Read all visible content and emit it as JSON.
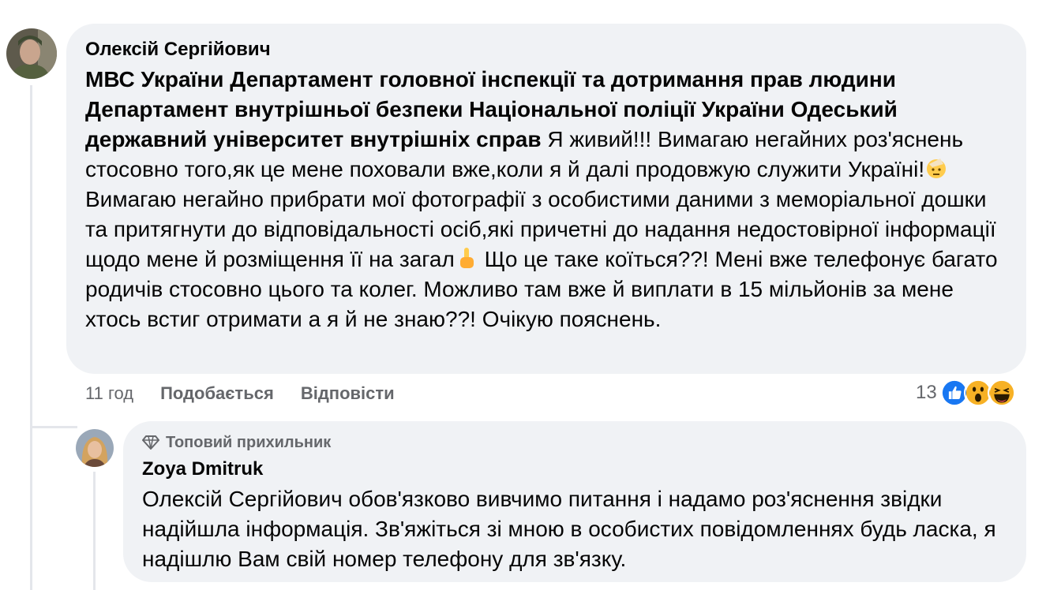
{
  "comment": {
    "author": "Олексій Сергійович",
    "tags": "МВС України Департамент головної інспекції та дотримання прав людини Департамент внутрішньої безпеки Національної поліції України Одеський державний університет внутрішніх справ",
    "text_1": "Я живий!!! Вимагаю негайних роз'яснень стосовно того,як це мене поховали вже,коли я й далі продовжую служити Україні!",
    "text_2": "Вимагаю негайно прибрати мої фотографії з особистими даними з меморіальної дошки та притягнути до відповідальності осіб,які причетні до надання недостовірної інформації щодо мене й розміщення її на загал",
    "text_3": "Що це таке коїться??! Мені вже телефонує багато родичів стосовно цього та колег. Можливо там вже й виплати в 15 мільйонів за мене хтось встиг отримати а я й не знаю??! Очікую пояснень.",
    "time": "11 год",
    "like_label": "Подобається",
    "reply_label": "Відповісти",
    "reaction_count": "13",
    "reaction_icons": [
      "like-icon",
      "wow-icon",
      "haha-icon"
    ],
    "inline_emojis": [
      "salute-emoji-icon",
      "pointing-up-emoji-icon"
    ]
  },
  "reply": {
    "badge_icon": "diamond-icon",
    "badge": "Топовий прихильник",
    "author": "Zoya Dmitruk",
    "text": "Олексій Сергійович обов'язково вивчимо питання і надамо роз'яснення звідки надійшла інформація. Зв'яжіться зі мною в особистих повідомленнях будь ласка, я надішлю Вам свій номер телефону для зв'язку."
  },
  "colors": {
    "bubble": "#f0f2f5",
    "meta": "#65676b",
    "like_blue": "#1877f2",
    "thread_line": "#e4e6eb"
  }
}
